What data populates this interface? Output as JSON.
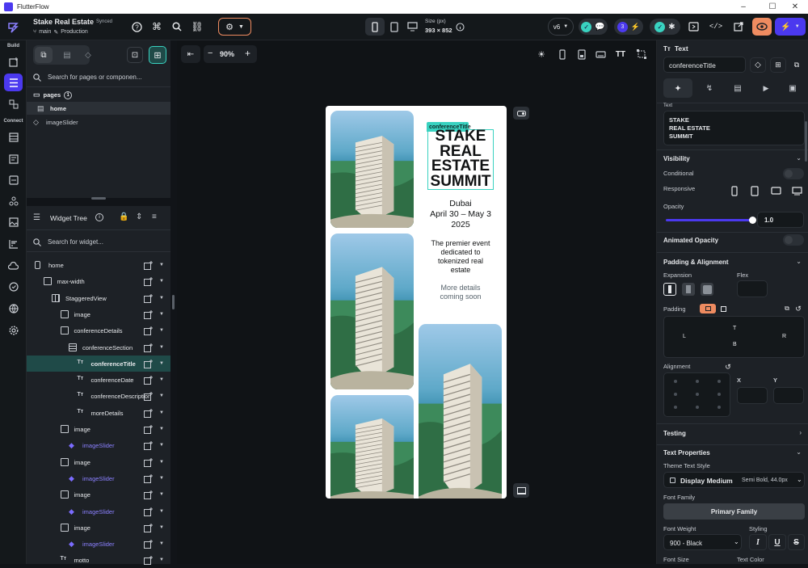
{
  "window": {
    "title": "FlutterFlow",
    "controls": {
      "minimize": "–",
      "maximize": "☐",
      "close": "✕"
    }
  },
  "project": {
    "name": "Stake Real Estate",
    "sync_status": "Synced",
    "branch": "main",
    "env": "Production"
  },
  "device_size": {
    "label": "Size (px)",
    "value": "393 × 852"
  },
  "version": "v6",
  "notifications_count": "3",
  "rail": {
    "build_label": "Build",
    "connect_label": "Connect"
  },
  "pages_panel": {
    "search_placeholder": "Search for pages or componen...",
    "folder_label": "pages",
    "folder_count": "1",
    "items": [
      {
        "label": "home"
      },
      {
        "label": "imageSlider"
      }
    ]
  },
  "widget_tree": {
    "title": "Widget Tree",
    "search_placeholder": "Search for widget...",
    "rows": [
      {
        "label": "home"
      },
      {
        "label": "max-width"
      },
      {
        "label": "StaggeredView"
      },
      {
        "label": "image"
      },
      {
        "label": "conferenceDetails"
      },
      {
        "label": "conferenceSection"
      },
      {
        "label": "conferenceTitle"
      },
      {
        "label": "conferenceDate"
      },
      {
        "label": "conferenceDescription"
      },
      {
        "label": "moreDetails"
      },
      {
        "label": "image"
      },
      {
        "label": "imageSlider"
      },
      {
        "label": "image"
      },
      {
        "label": "imageSlider"
      },
      {
        "label": "image"
      },
      {
        "label": "imageSlider"
      },
      {
        "label": "image"
      },
      {
        "label": "imageSlider"
      },
      {
        "label": "motto"
      }
    ]
  },
  "canvas": {
    "zoom": "90%",
    "selection_tag": "conferenceTitle",
    "title_lines": [
      "STAKE",
      "REAL",
      "ESTATE",
      "SUMMIT"
    ],
    "city": "Dubai",
    "dates": "April 30 – May 3",
    "year": "2025",
    "description_lines": [
      "The premier event",
      "dedicated to",
      "tokenized real",
      "estate"
    ],
    "more_lines": [
      "More details",
      "coming soon"
    ]
  },
  "properties": {
    "widget_type": "Text",
    "widget_name": "conferenceTitle",
    "text_label": "Text",
    "text_value_lines": [
      "STAKE",
      "REAL ESTATE",
      "SUMMIT"
    ],
    "visibility": {
      "title": "Visibility",
      "conditional": "Conditional",
      "responsive": "Responsive",
      "opacity_label": "Opacity",
      "opacity_value": "1.0",
      "opacity_fraction": 1.0
    },
    "animated_opacity": "Animated Opacity",
    "padding_alignment": {
      "title": "Padding & Alignment",
      "expansion": "Expansion",
      "flex": "Flex",
      "padding": "Padding",
      "pad_top": "T",
      "pad_bottom": "B",
      "pad_left": "L",
      "pad_right": "R",
      "alignment": "Alignment",
      "x_label": "X",
      "y_label": "Y"
    },
    "testing": "Testing",
    "text_properties": {
      "title": "Text Properties",
      "theme_label": "Theme Text Style",
      "theme_value": "Display Medium",
      "theme_meta": "Semi Bold, 44.0px",
      "font_family_label": "Font Family",
      "font_family_value": "Primary Family",
      "font_weight_label": "Font Weight",
      "font_weight_value": "900 - Black",
      "styling_label": "Styling",
      "font_size_label": "Font Size",
      "text_color_label": "Text Color"
    }
  },
  "colors": {
    "accent": "#4b39ef",
    "selection": "#1f4a48",
    "teal": "#39d2c0",
    "orange": "#ee8b60",
    "panel": "#1d2126",
    "bg": "#111418"
  }
}
